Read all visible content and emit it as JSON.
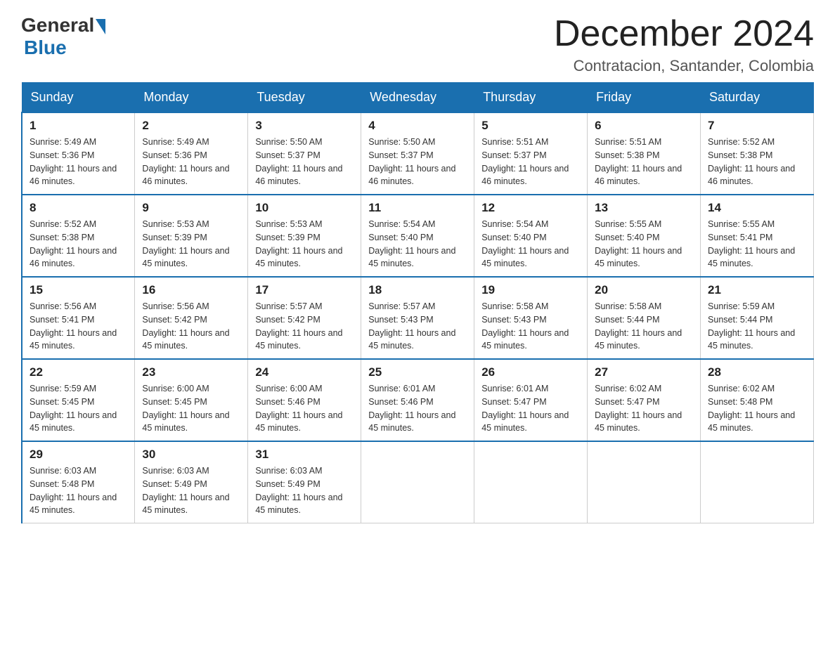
{
  "header": {
    "logo_general": "General",
    "logo_blue": "Blue",
    "month_title": "December 2024",
    "location": "Contratacion, Santander, Colombia"
  },
  "days_of_week": [
    "Sunday",
    "Monday",
    "Tuesday",
    "Wednesday",
    "Thursday",
    "Friday",
    "Saturday"
  ],
  "weeks": [
    [
      {
        "day": "1",
        "sunrise": "5:49 AM",
        "sunset": "5:36 PM",
        "daylight": "11 hours and 46 minutes."
      },
      {
        "day": "2",
        "sunrise": "5:49 AM",
        "sunset": "5:36 PM",
        "daylight": "11 hours and 46 minutes."
      },
      {
        "day": "3",
        "sunrise": "5:50 AM",
        "sunset": "5:37 PM",
        "daylight": "11 hours and 46 minutes."
      },
      {
        "day": "4",
        "sunrise": "5:50 AM",
        "sunset": "5:37 PM",
        "daylight": "11 hours and 46 minutes."
      },
      {
        "day": "5",
        "sunrise": "5:51 AM",
        "sunset": "5:37 PM",
        "daylight": "11 hours and 46 minutes."
      },
      {
        "day": "6",
        "sunrise": "5:51 AM",
        "sunset": "5:38 PM",
        "daylight": "11 hours and 46 minutes."
      },
      {
        "day": "7",
        "sunrise": "5:52 AM",
        "sunset": "5:38 PM",
        "daylight": "11 hours and 46 minutes."
      }
    ],
    [
      {
        "day": "8",
        "sunrise": "5:52 AM",
        "sunset": "5:38 PM",
        "daylight": "11 hours and 46 minutes."
      },
      {
        "day": "9",
        "sunrise": "5:53 AM",
        "sunset": "5:39 PM",
        "daylight": "11 hours and 45 minutes."
      },
      {
        "day": "10",
        "sunrise": "5:53 AM",
        "sunset": "5:39 PM",
        "daylight": "11 hours and 45 minutes."
      },
      {
        "day": "11",
        "sunrise": "5:54 AM",
        "sunset": "5:40 PM",
        "daylight": "11 hours and 45 minutes."
      },
      {
        "day": "12",
        "sunrise": "5:54 AM",
        "sunset": "5:40 PM",
        "daylight": "11 hours and 45 minutes."
      },
      {
        "day": "13",
        "sunrise": "5:55 AM",
        "sunset": "5:40 PM",
        "daylight": "11 hours and 45 minutes."
      },
      {
        "day": "14",
        "sunrise": "5:55 AM",
        "sunset": "5:41 PM",
        "daylight": "11 hours and 45 minutes."
      }
    ],
    [
      {
        "day": "15",
        "sunrise": "5:56 AM",
        "sunset": "5:41 PM",
        "daylight": "11 hours and 45 minutes."
      },
      {
        "day": "16",
        "sunrise": "5:56 AM",
        "sunset": "5:42 PM",
        "daylight": "11 hours and 45 minutes."
      },
      {
        "day": "17",
        "sunrise": "5:57 AM",
        "sunset": "5:42 PM",
        "daylight": "11 hours and 45 minutes."
      },
      {
        "day": "18",
        "sunrise": "5:57 AM",
        "sunset": "5:43 PM",
        "daylight": "11 hours and 45 minutes."
      },
      {
        "day": "19",
        "sunrise": "5:58 AM",
        "sunset": "5:43 PM",
        "daylight": "11 hours and 45 minutes."
      },
      {
        "day": "20",
        "sunrise": "5:58 AM",
        "sunset": "5:44 PM",
        "daylight": "11 hours and 45 minutes."
      },
      {
        "day": "21",
        "sunrise": "5:59 AM",
        "sunset": "5:44 PM",
        "daylight": "11 hours and 45 minutes."
      }
    ],
    [
      {
        "day": "22",
        "sunrise": "5:59 AM",
        "sunset": "5:45 PM",
        "daylight": "11 hours and 45 minutes."
      },
      {
        "day": "23",
        "sunrise": "6:00 AM",
        "sunset": "5:45 PM",
        "daylight": "11 hours and 45 minutes."
      },
      {
        "day": "24",
        "sunrise": "6:00 AM",
        "sunset": "5:46 PM",
        "daylight": "11 hours and 45 minutes."
      },
      {
        "day": "25",
        "sunrise": "6:01 AM",
        "sunset": "5:46 PM",
        "daylight": "11 hours and 45 minutes."
      },
      {
        "day": "26",
        "sunrise": "6:01 AM",
        "sunset": "5:47 PM",
        "daylight": "11 hours and 45 minutes."
      },
      {
        "day": "27",
        "sunrise": "6:02 AM",
        "sunset": "5:47 PM",
        "daylight": "11 hours and 45 minutes."
      },
      {
        "day": "28",
        "sunrise": "6:02 AM",
        "sunset": "5:48 PM",
        "daylight": "11 hours and 45 minutes."
      }
    ],
    [
      {
        "day": "29",
        "sunrise": "6:03 AM",
        "sunset": "5:48 PM",
        "daylight": "11 hours and 45 minutes."
      },
      {
        "day": "30",
        "sunrise": "6:03 AM",
        "sunset": "5:49 PM",
        "daylight": "11 hours and 45 minutes."
      },
      {
        "day": "31",
        "sunrise": "6:03 AM",
        "sunset": "5:49 PM",
        "daylight": "11 hours and 45 minutes."
      },
      null,
      null,
      null,
      null
    ]
  ]
}
